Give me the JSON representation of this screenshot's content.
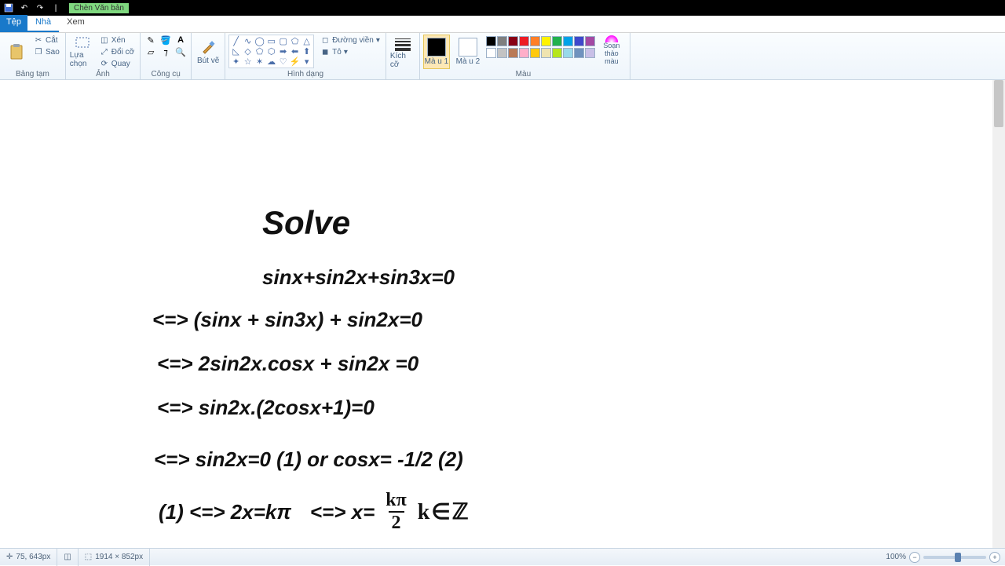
{
  "titlebar": {
    "doc_hint": "Chèn Văn bản"
  },
  "tabs": {
    "file": "Tệp",
    "home": "Nhà",
    "view": "Xem"
  },
  "ribbon": {
    "clipboard": {
      "label": "Bảng tạm",
      "cut": "Cắt",
      "copy": "Sao"
    },
    "image": {
      "label": "Ảnh",
      "select": "Lựa chọn",
      "crop": "Xén",
      "resize": "Đổi cỡ",
      "rotate": "Quay"
    },
    "tools": {
      "label": "Công cụ"
    },
    "brushes": {
      "label": "Bút vẽ",
      "btn": "Bút vẽ"
    },
    "shapes": {
      "label": "Hình dạng",
      "outline": "Đường viền",
      "fill": "Tô"
    },
    "size": {
      "label": "Kích cỡ",
      "btn": "Kích cỡ"
    },
    "colors": {
      "label": "Màu",
      "c1": "Mà u 1",
      "c2": "Mà u 2",
      "edit": "Soạn thảo màu",
      "c1_value": "#000000",
      "c2_value": "#ffffff",
      "row1": [
        "#000000",
        "#7f7f7f",
        "#880015",
        "#ed1c24",
        "#ff7f27",
        "#fff200",
        "#22b14c",
        "#00a2e8",
        "#3f48cc",
        "#a349a4"
      ],
      "row2": [
        "#ffffff",
        "#c3c3c3",
        "#b97a57",
        "#ffaec9",
        "#ffc90e",
        "#efe4b0",
        "#b5e61d",
        "#99d9ea",
        "#7092be",
        "#c8bfe7"
      ]
    }
  },
  "canvas_text": {
    "title": "Solve",
    "l1": "sinx+sin2x+sin3x=0",
    "l2": "<=> (sinx + sin3x) + sin2x=0",
    "l3": "<=> 2sin2x.cosx + sin2x =0",
    "l4": "<=> sin2x.(2cosx+1)=0",
    "l5": "<=> sin2x=0 (1) or cosx= -1/2 (2)",
    "l6a": "(1) <=> 2x=kπ",
    "l6b": "<=> x=",
    "frac_num": "kπ",
    "frac_den": "2",
    "l6c": "k∈ℤ"
  },
  "status": {
    "cursor": "75, 643px",
    "canvas_size": "1914 × 852px",
    "zoom": "100%"
  }
}
